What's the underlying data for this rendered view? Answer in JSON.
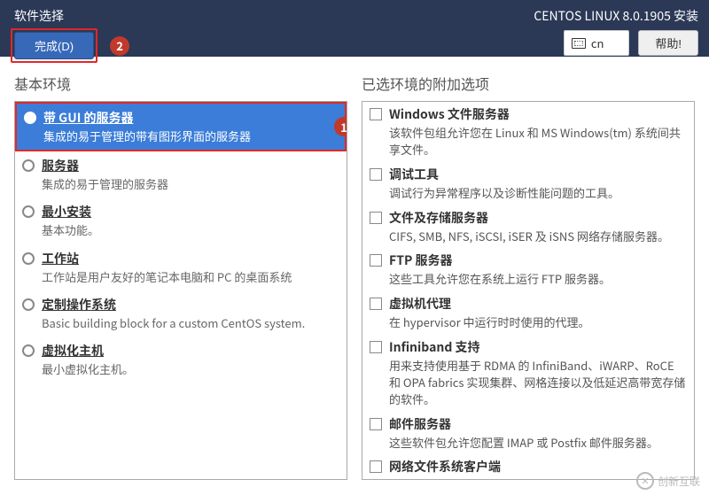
{
  "header": {
    "page_title": "软件选择",
    "done_label": "完成(D)",
    "install_title": "CENTOS LINUX 8.0.1905 安装",
    "lang_label": "cn",
    "help_label": "帮助!"
  },
  "markers": {
    "m1": "1",
    "m2": "2"
  },
  "left": {
    "title": "基本环境",
    "items": [
      {
        "selected": true,
        "name": "带 GUI 的服务器",
        "desc": "集成的易于管理的带有图形界面的服务器"
      },
      {
        "selected": false,
        "name": "服务器",
        "desc": "集成的易于管理的服务器"
      },
      {
        "selected": false,
        "name": "最小安装",
        "desc": "基本功能。"
      },
      {
        "selected": false,
        "name": "工作站",
        "desc": "工作站是用户友好的笔记本电脑和 PC 的桌面系统"
      },
      {
        "selected": false,
        "name": "定制操作系统",
        "desc": "Basic building block for a custom CentOS system."
      },
      {
        "selected": false,
        "name": "虚拟化主机",
        "desc": "最小虚拟化主机。"
      }
    ]
  },
  "right": {
    "title": "已选环境的附加选项",
    "items": [
      {
        "name": "Windows 文件服务器",
        "desc": "该软件包组允许您在 Linux 和 MS Windows(tm) 系统间共享文件。"
      },
      {
        "name": "调试工具",
        "desc": "调试行为异常程序以及诊断性能问题的工具。"
      },
      {
        "name": "文件及存储服务器",
        "desc": "CIFS, SMB, NFS, iSCSI, iSER 及 iSNS 网络存储服务器。"
      },
      {
        "name": "FTP 服务器",
        "desc": "这些工具允许您在系统上运行 FTP 服务器。"
      },
      {
        "name": "虚拟机代理",
        "desc": "在 hypervisor 中运行时时使用的代理。"
      },
      {
        "name": "Infiniband 支持",
        "desc": "用来支持使用基于 RDMA 的 InfiniBand、iWARP、RoCE 和 OPA fabrics 实现集群、网格连接以及低延迟高带宽存储的软件。"
      },
      {
        "name": "邮件服务器",
        "desc": "这些软件包允许您配置 IMAP 或 Postfix 邮件服务器。"
      },
      {
        "name": "网络文件系统客户端",
        "desc": ""
      }
    ]
  },
  "watermark": "创新互联"
}
